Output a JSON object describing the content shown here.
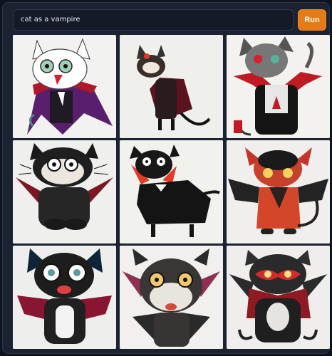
{
  "prompt": {
    "value": "cat as a vampire"
  },
  "run_button": {
    "label": "Run"
  },
  "results": {
    "images": [
      {
        "subject": "cat-vampire-1",
        "background": "#f2f2f0"
      },
      {
        "subject": "cat-vampire-2",
        "background": "#efefec"
      },
      {
        "subject": "cat-vampire-3",
        "background": "#f3f2ef"
      },
      {
        "subject": "cat-vampire-4",
        "background": "#efefed"
      },
      {
        "subject": "cat-vampire-5",
        "background": "#f1f1ee"
      },
      {
        "subject": "cat-vampire-6",
        "background": "#f0efed"
      },
      {
        "subject": "cat-vampire-7",
        "background": "#eeeeec"
      },
      {
        "subject": "cat-vampire-8",
        "background": "#f1f0ee"
      },
      {
        "subject": "cat-vampire-9",
        "background": "#efeeec"
      }
    ]
  }
}
